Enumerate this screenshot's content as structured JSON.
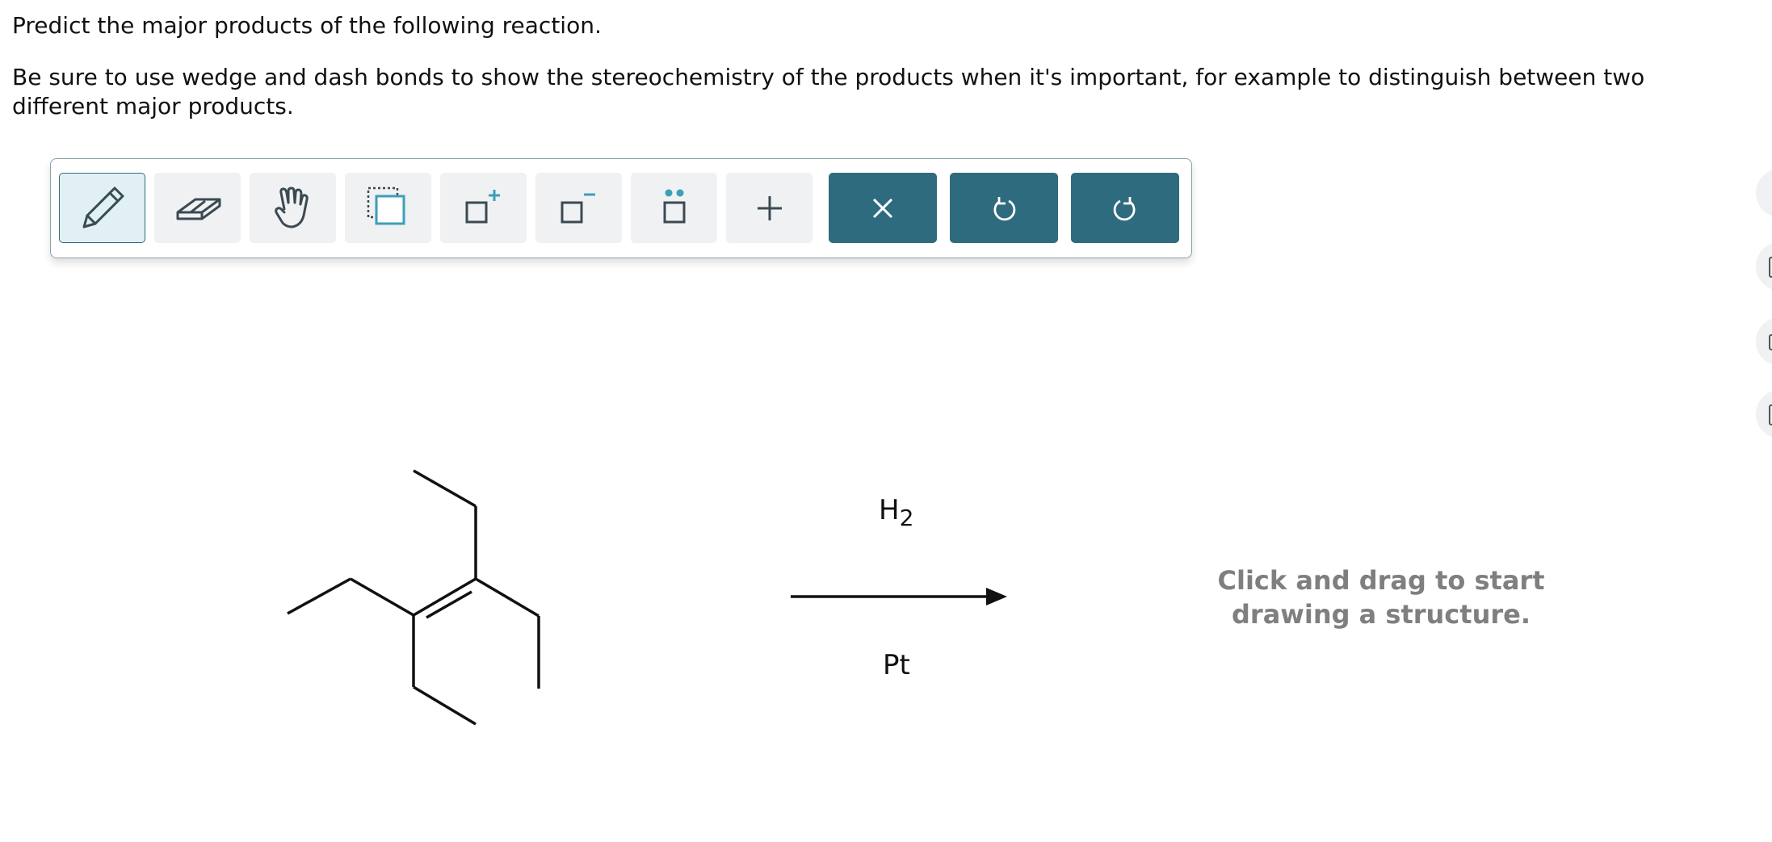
{
  "question": {
    "line1": "Predict the major products of the following reaction.",
    "line2": "Be sure to use wedge and dash bonds to show the stereochemistry of the products when it's important, for example to distinguish between two different major products."
  },
  "toolbar": {
    "tools": [
      {
        "name": "pencil-icon",
        "state": "selected"
      },
      {
        "name": "eraser-icon"
      },
      {
        "name": "hand-icon"
      },
      {
        "name": "select-box-icon"
      },
      {
        "name": "increase-charge-icon"
      },
      {
        "name": "decrease-charge-icon"
      },
      {
        "name": "lone-pair-icon"
      },
      {
        "name": "plus-icon"
      }
    ],
    "actions": [
      {
        "name": "close-icon"
      },
      {
        "name": "undo-icon"
      },
      {
        "name": "redo-icon"
      }
    ]
  },
  "reaction": {
    "reagent_main": "H",
    "reagent_subscript": "2",
    "catalyst": "Pt"
  },
  "canvas": {
    "hint": "Click and drag to start drawing a structure."
  },
  "colors": {
    "accent_dark": "#2f6b7e",
    "tool_bg": "#f0f1f2",
    "tool_selected_bg": "#e1f0f4",
    "icon_teal": "#3d9fb8",
    "hint_text": "#7f7f7f"
  }
}
